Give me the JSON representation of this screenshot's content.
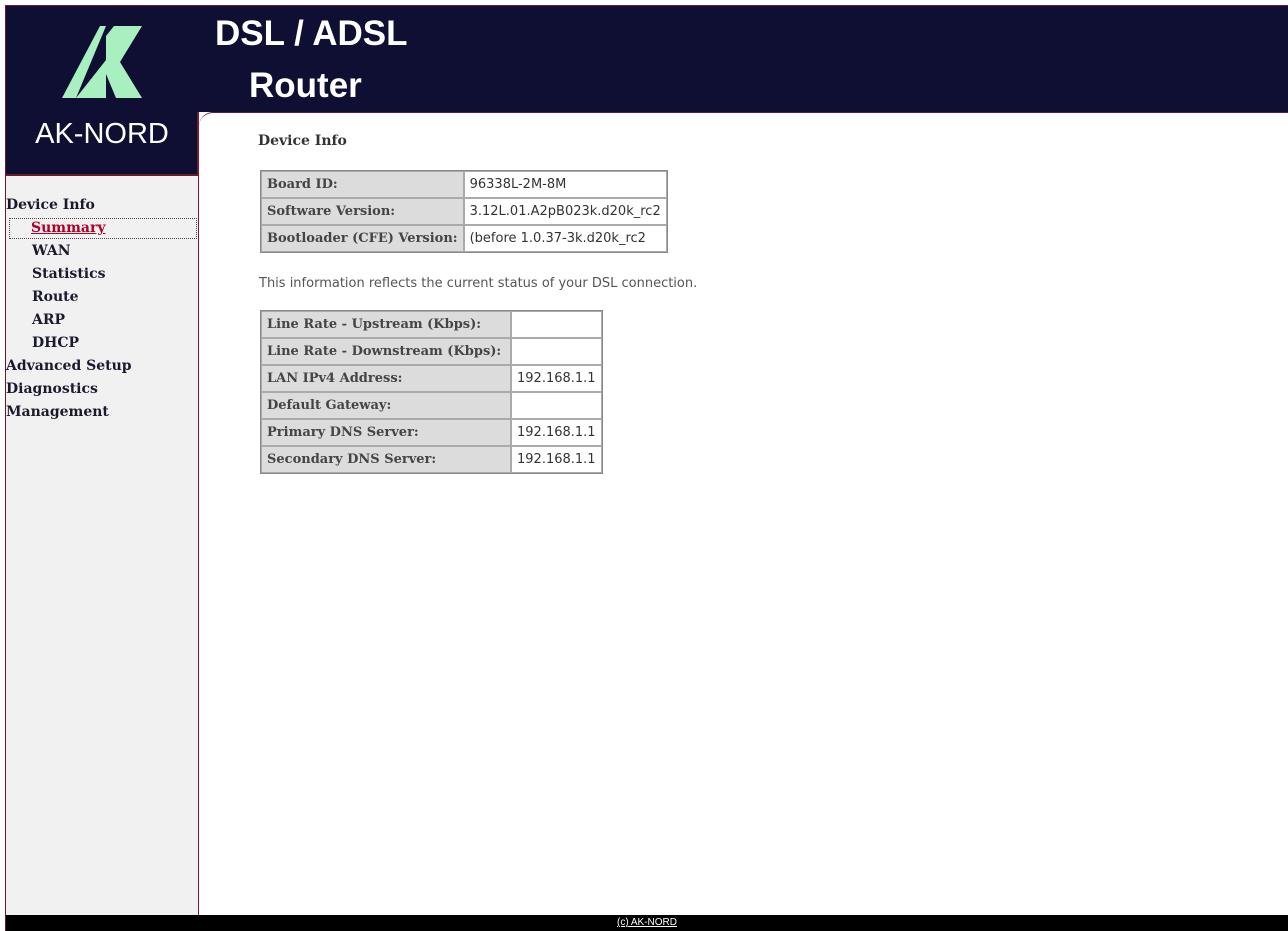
{
  "brand": {
    "name": "AK-NORD",
    "product_line1": "DSL / ADSL",
    "product_line2": "Router",
    "colors": {
      "header_bg": "#0f0f33",
      "logo_green": "#a8f0c0",
      "accent": "#7a1a2a",
      "active_link": "#b0002a"
    }
  },
  "sidebar": {
    "items": [
      {
        "label": "Device Info",
        "level": 0
      },
      {
        "label": "Summary",
        "level": 1,
        "active": true
      },
      {
        "label": "WAN",
        "level": 1
      },
      {
        "label": "Statistics",
        "level": 1
      },
      {
        "label": "Route",
        "level": 1
      },
      {
        "label": "ARP",
        "level": 1
      },
      {
        "label": "DHCP",
        "level": 1
      },
      {
        "label": "Advanced Setup",
        "level": 0
      },
      {
        "label": "Diagnostics",
        "level": 0
      },
      {
        "label": "Management",
        "level": 0
      }
    ]
  },
  "main": {
    "title": "Device Info",
    "device_table": [
      {
        "label": "Board ID:",
        "value": "96338L-2M-8M"
      },
      {
        "label": "Software Version:",
        "value": "3.12L.01.A2pB023k.d20k_rc2"
      },
      {
        "label": "Bootloader (CFE) Version:",
        "value": "(before 1.0.37-3k.d20k_rc2"
      }
    ],
    "status_note": "This information reflects the current status of your DSL connection.",
    "status_table": [
      {
        "label": "Line Rate - Upstream (Kbps):",
        "value": ""
      },
      {
        "label": "Line Rate - Downstream (Kbps):",
        "value": ""
      },
      {
        "label": "LAN IPv4 Address:",
        "value": "192.168.1.1"
      },
      {
        "label": "Default Gateway:",
        "value": ""
      },
      {
        "label": "Primary DNS Server:",
        "value": "192.168.1.1"
      },
      {
        "label": "Secondary DNS Server:",
        "value": "192.168.1.1"
      }
    ]
  },
  "footer": {
    "copyright": "(c) AK-NORD"
  }
}
